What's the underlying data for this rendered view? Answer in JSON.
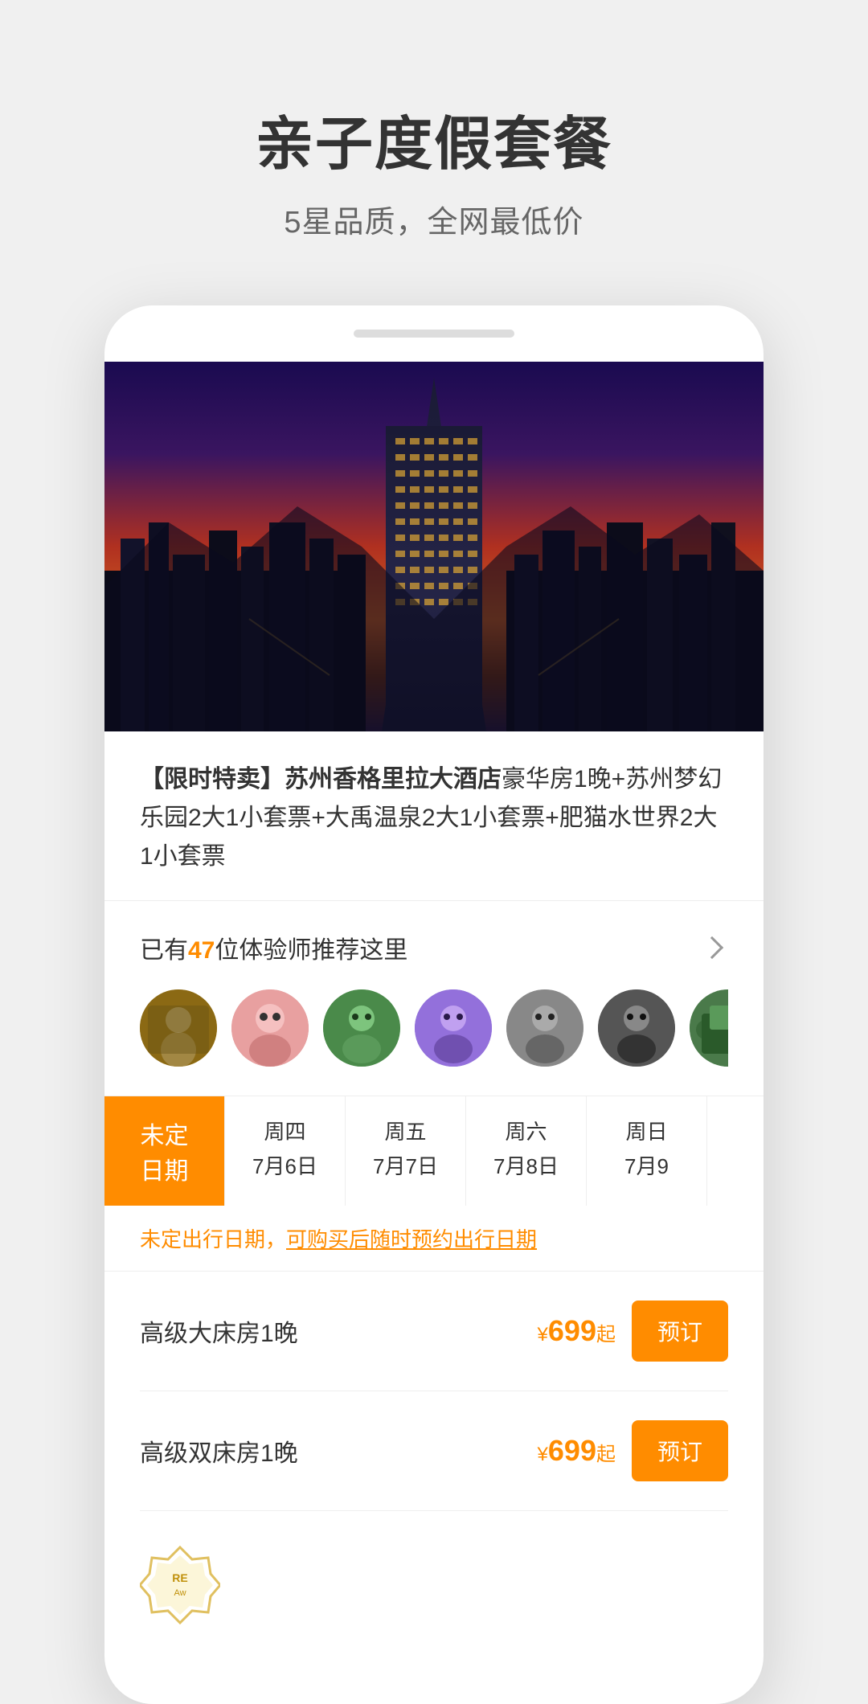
{
  "header": {
    "title": "亲子度假套餐",
    "subtitle": "5星品质，全网最低价"
  },
  "hotel": {
    "tag": "【限时特卖】",
    "name": "苏州香格里拉大酒店",
    "description": "豪华房1晚+苏州梦幻乐园2大1小套票+大禹温泉2大1小套票+肥猫水世界2大1小套票"
  },
  "reviewers": {
    "prefix": "已有",
    "count": "47",
    "suffix": "位体验师推荐这里",
    "chevron": "›"
  },
  "dates": [
    {
      "label": "未定\n日期",
      "day": "",
      "active": true
    },
    {
      "label": "周四",
      "day": "7月6日",
      "active": false
    },
    {
      "label": "周五",
      "day": "7月7日",
      "active": false
    },
    {
      "label": "周六",
      "day": "7月8日",
      "active": false
    },
    {
      "label": "周日",
      "day": "7月9",
      "active": false
    }
  ],
  "date_notice": {
    "text": "未定出行日期，",
    "link": "可购买后随时预约出行日期"
  },
  "rooms": [
    {
      "name": "高级大床房1晚",
      "price": "¥699起",
      "currency": "¥",
      "amount": "699",
      "suffix": "起",
      "book_label": "预订"
    },
    {
      "name": "高级双床房1晚",
      "price": "¥699起",
      "currency": "¥",
      "amount": "699",
      "suffix": "起",
      "book_label": "预订"
    }
  ],
  "award": {
    "text": "RE Aw"
  }
}
